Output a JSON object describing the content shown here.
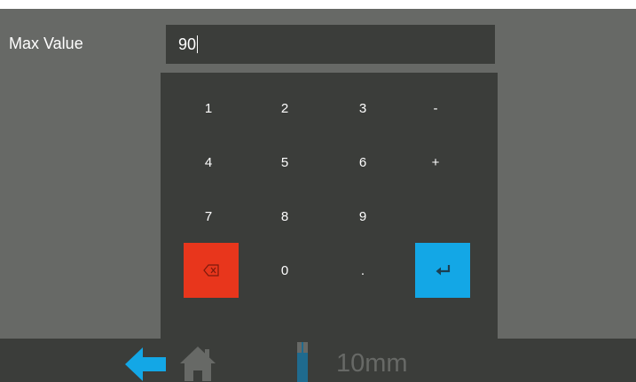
{
  "field": {
    "label": "Max Value",
    "value": "90"
  },
  "keypad": {
    "keys": [
      "1",
      "2",
      "3",
      "-",
      "4",
      "5",
      "6",
      "+",
      "7",
      "8",
      "9",
      "0",
      "."
    ],
    "colors": {
      "panel": "#3b3d3a",
      "backspace": "#e8361c",
      "enter": "#13a7e6"
    }
  },
  "footer": {
    "icons": [
      "back-arrow-icon",
      "home-icon",
      "tool-icon"
    ],
    "length": "10mm",
    "accent": "#13a7e6"
  }
}
